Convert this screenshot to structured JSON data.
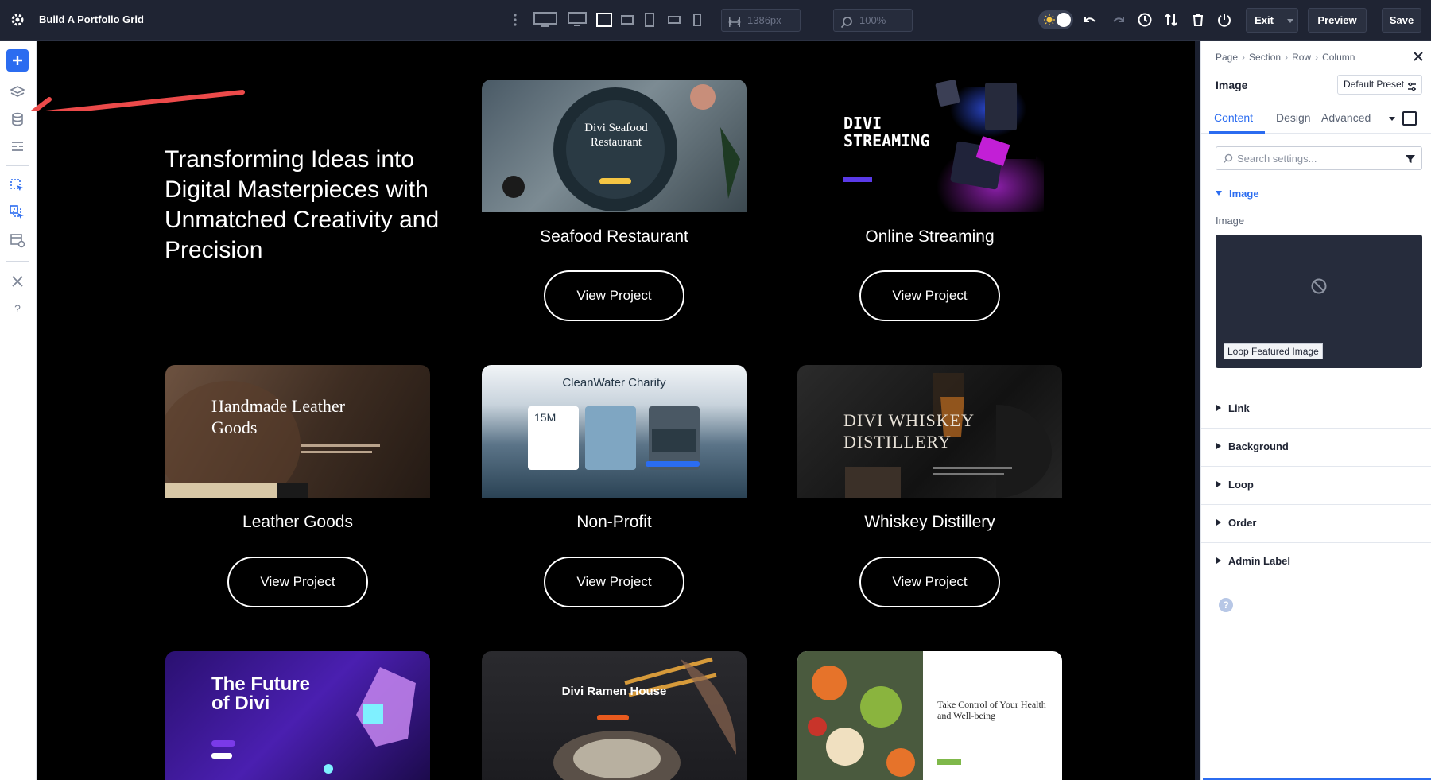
{
  "topbar": {
    "title": "Build A Portfolio Grid",
    "width_field": "1386px",
    "zoom_field": "100%",
    "exit_label": "Exit",
    "preview_label": "Preview",
    "save_label": "Save",
    "accent": "#2b6cf0"
  },
  "canvas": {
    "hero_text": "Transforming Ideas into Digital Masterpieces with Unmatched Creativity and Precision",
    "button_label": "View Project",
    "cards": [
      {
        "title": "Seafood Restaurant",
        "image_text": "Divi Seafood Restaurant"
      },
      {
        "title": "Online Streaming",
        "image_text": "DIVI STREAMING"
      },
      {
        "title": "Leather Goods",
        "image_text": "Handmade Leather Goods"
      },
      {
        "title": "Non-Profit",
        "image_text": "CleanWater Charity",
        "image_stat": "15M"
      },
      {
        "title": "Whiskey Distillery",
        "image_text": "DIVI WHISKEY DISTILLERY"
      },
      {
        "title": "",
        "image_text": "The Future of Divi"
      },
      {
        "title": "",
        "image_text": "Divi Ramen House"
      },
      {
        "title": "",
        "image_text": "Take Control of Your Health and Well-being"
      }
    ]
  },
  "panel": {
    "breadcrumbs": [
      "Page",
      "Section",
      "Row",
      "Column"
    ],
    "module_name": "Image",
    "preset": "Default Preset",
    "tabs": [
      "Content",
      "Design",
      "Advanced"
    ],
    "active_tab": "Content",
    "search_placeholder": "Search settings...",
    "group": "Image",
    "field_label": "Image",
    "image_tag": "Loop Featured Image",
    "sections": [
      "Link",
      "Background",
      "Loop",
      "Order",
      "Admin Label"
    ]
  }
}
